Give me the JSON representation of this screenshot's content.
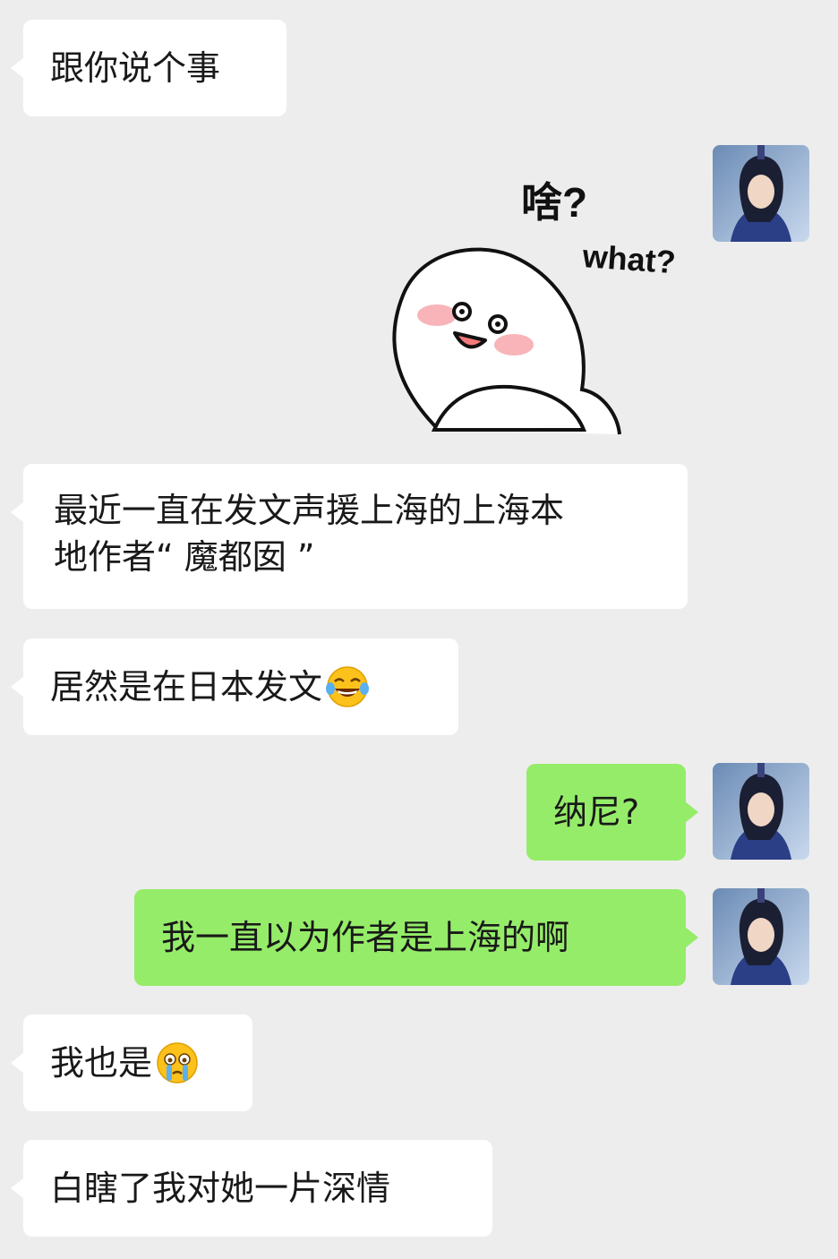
{
  "messages": [
    {
      "side": "in",
      "text": "跟你说个事"
    },
    {
      "side": "out",
      "type": "sticker",
      "sticker_text": [
        "啥?",
        "what?"
      ]
    },
    {
      "side": "in",
      "lines": [
        "最近一直在发文声援上海的上海本",
        "地作者“ 魔都囡 ”"
      ]
    },
    {
      "side": "in",
      "text": "居然是在日本发文",
      "emoji": "tears-of-joy-emoji"
    },
    {
      "side": "out",
      "text": "纳尼?"
    },
    {
      "side": "out",
      "text": "我一直以为作者是上海的啊"
    },
    {
      "side": "in",
      "text": "我也是",
      "emoji": "crying-emoji"
    },
    {
      "side": "in",
      "text": "白瞎了我对她一片深情"
    }
  ],
  "colors": {
    "background": "#ededed",
    "incoming_bubble": "#ffffff",
    "outgoing_bubble": "#95ec69",
    "text": "#191919"
  },
  "avatar": {
    "icon": "user-avatar-icon"
  }
}
